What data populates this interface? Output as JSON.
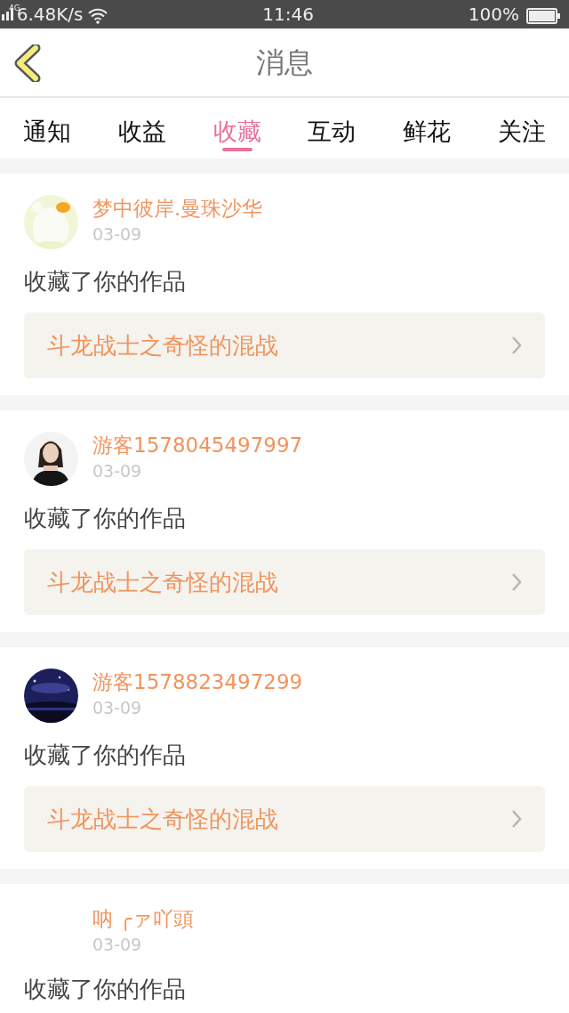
{
  "status_bar": {
    "network": "4G",
    "speed": "6.48K/s",
    "time": "11:46",
    "battery": "100%"
  },
  "header": {
    "title": "消息"
  },
  "tabs": [
    {
      "label": "通知",
      "selected": false
    },
    {
      "label": "收益",
      "selected": false
    },
    {
      "label": "收藏",
      "selected": true
    },
    {
      "label": "互动",
      "selected": false
    },
    {
      "label": "鲜花",
      "selected": false
    },
    {
      "label": "关注",
      "selected": false
    }
  ],
  "messages": [
    {
      "user": "梦中彼岸.曼珠沙华",
      "date": "03-09",
      "action": "收藏了你的作品",
      "work": "斗龙战士之奇怪的混战"
    },
    {
      "user": "游客1578045497997",
      "date": "03-09",
      "action": "收藏了你的作品",
      "work": "斗龙战士之奇怪的混战"
    },
    {
      "user": "游客1578823497299",
      "date": "03-09",
      "action": "收藏了你的作品",
      "work": "斗龙战士之奇怪的混战"
    },
    {
      "user": "呐 ╭ァ吖頭",
      "date": "03-09",
      "action": "收藏了你的作品"
    }
  ]
}
